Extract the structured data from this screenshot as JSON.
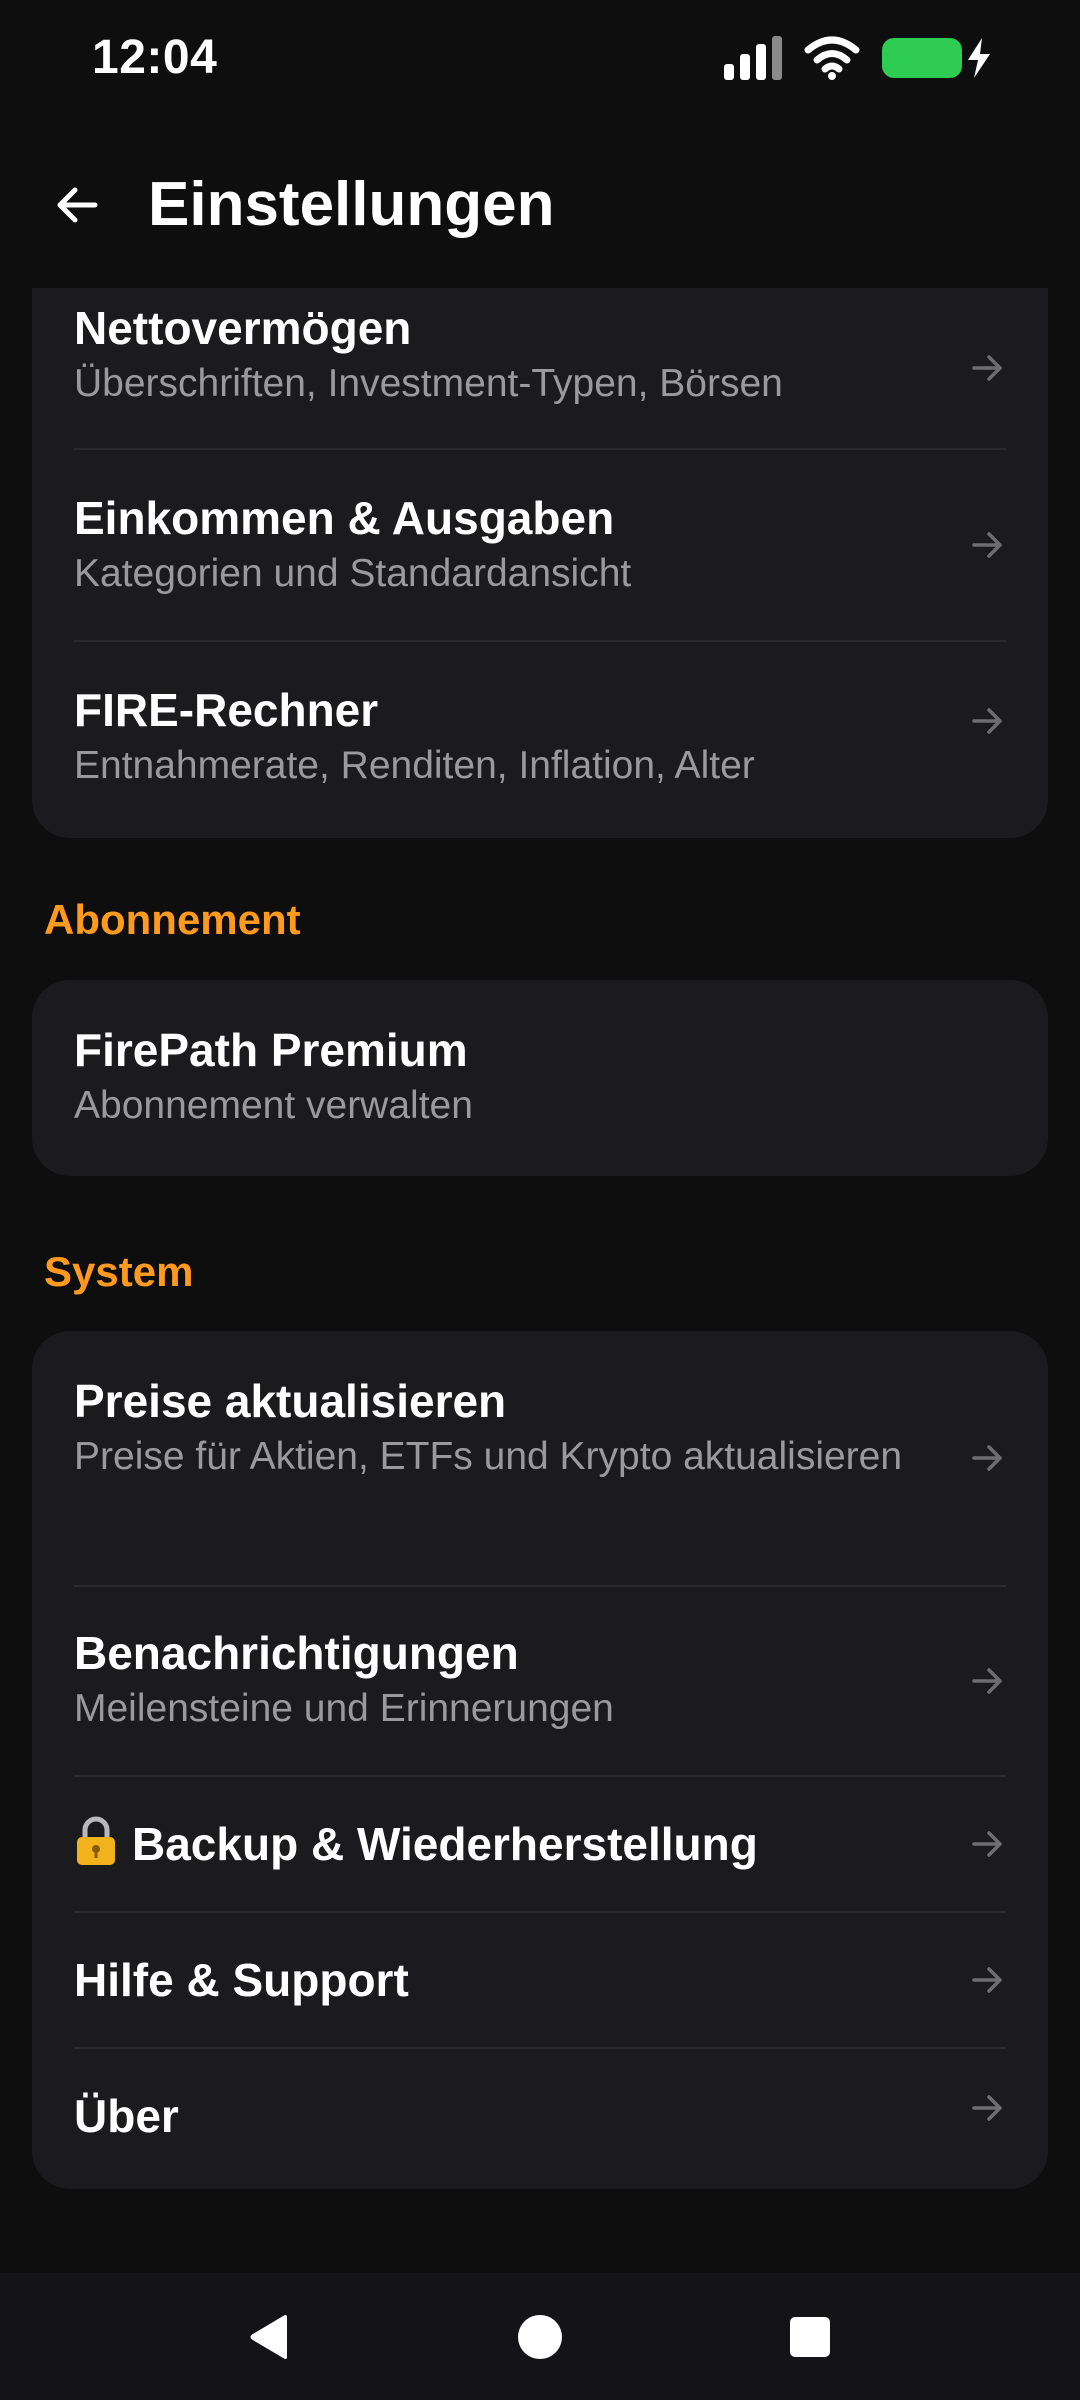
{
  "status_bar": {
    "time": "12:04"
  },
  "header": {
    "title": "Einstellungen",
    "back_icon": "arrow-left-icon"
  },
  "top_card": {
    "items": [
      {
        "title": "Nettovermögen",
        "subtitle": "Überschriften, Investment-Typen, Börsen"
      },
      {
        "title": "Einkommen & Ausgaben",
        "subtitle": "Kategorien und Standardansicht"
      },
      {
        "title": "FIRE-Rechner",
        "subtitle": "Entnahmerate, Renditen, Inflation, Alter"
      }
    ]
  },
  "subscription": {
    "section_label": "Abonnement",
    "item": {
      "title": "FirePath Premium",
      "subtitle": "Abonnement verwalten"
    }
  },
  "system": {
    "section_label": "System",
    "items": [
      {
        "title": "Preise aktualisieren",
        "subtitle": "Preise für Aktien, ETFs und Krypto aktualisieren"
      },
      {
        "title": "Benachrichtigungen",
        "subtitle": "Meilensteine und Erinnerungen"
      },
      {
        "title": "Backup & Wiederherstellung",
        "icon": "lock-icon"
      },
      {
        "title": "Hilfe & Support"
      },
      {
        "title": "Über"
      }
    ]
  },
  "colors": {
    "background": "#0e0e0f",
    "card": "#1b1b1d",
    "accent": "#ff9a1f",
    "subtitle": "#9a9a9d",
    "battery": "#2ecc52"
  }
}
